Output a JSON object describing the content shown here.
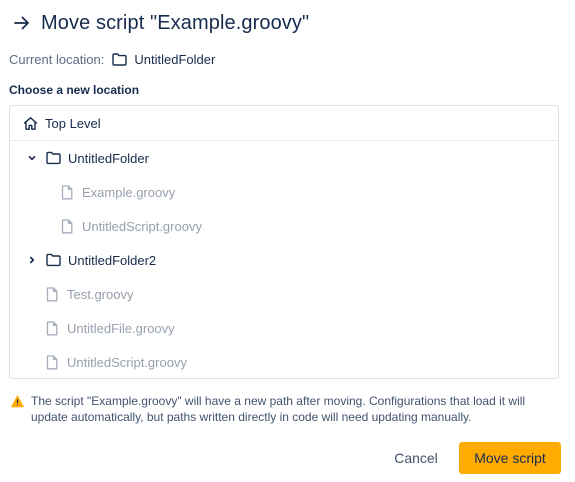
{
  "dialog": {
    "title": "Move script \"Example.groovy\"",
    "current_location_label": "Current location:",
    "current_location_value": "UntitledFolder",
    "choose_heading": "Choose a new location"
  },
  "tree": {
    "root": {
      "label": "Top Level",
      "icon": "home-icon"
    },
    "items": [
      {
        "label": "UntitledFolder",
        "type": "folder",
        "expanded": true,
        "icon": "folder-icon"
      },
      {
        "label": "Example.groovy",
        "type": "file",
        "icon": "file-icon"
      },
      {
        "label": "UntitledScript.groovy",
        "type": "file",
        "icon": "file-icon"
      },
      {
        "label": "UntitledFolder2",
        "type": "folder",
        "expanded": false,
        "icon": "folder-icon"
      },
      {
        "label": "Test.groovy",
        "type": "file",
        "icon": "file-icon"
      },
      {
        "label": "UntitledFile.groovy",
        "type": "file",
        "icon": "file-icon"
      },
      {
        "label": "UntitledScript.groovy",
        "type": "file",
        "icon": "file-icon"
      }
    ]
  },
  "warning": {
    "text": "The script \"Example.groovy\" will have a new path after moving. Configurations that load it will update automatically, but paths written directly in code will need updating manually.",
    "icon": "warning-icon",
    "color": "#ffab00"
  },
  "buttons": {
    "cancel_label": "Cancel",
    "move_label": "Move script",
    "primary_color": "#ffab00"
  }
}
